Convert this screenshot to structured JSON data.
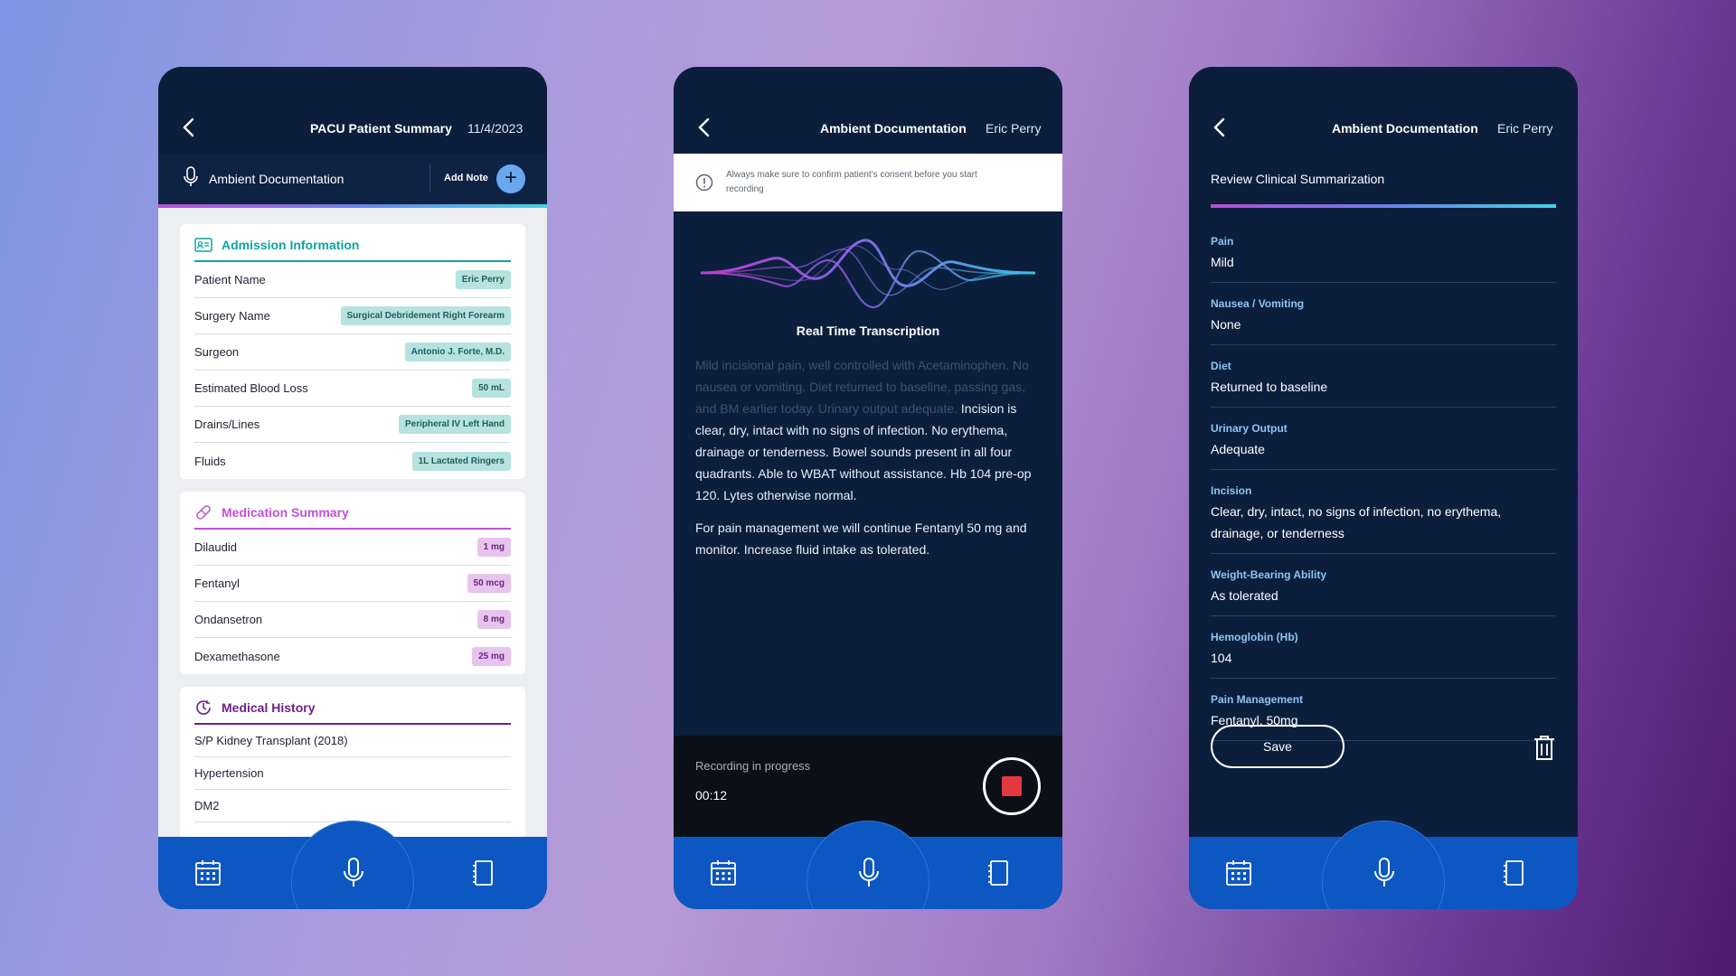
{
  "phone1": {
    "header": {
      "title": "PACU Patient Summary",
      "date": "11/4/2023"
    },
    "ambient_label": "Ambient Documentation",
    "add_note_label": "Add Note",
    "admission": {
      "title": "Admission Information",
      "accent": "#0fa3a3",
      "rows": [
        {
          "label": "Patient Name",
          "value": "Eric Perry"
        },
        {
          "label": "Surgery Name",
          "value": "Surgical Debridement Right Forearm"
        },
        {
          "label": "Surgeon",
          "value": "Antonio J. Forte, M.D."
        },
        {
          "label": "Estimated Blood Loss",
          "value": "50 mL"
        },
        {
          "label": "Drains/Lines",
          "value": "Peripheral IV Left Hand"
        },
        {
          "label": "Fluids",
          "value": "1L Lactated Ringers"
        }
      ]
    },
    "medication": {
      "title": "Medication Summary",
      "accent": "#c052d6",
      "rows": [
        {
          "label": "Dilaudid",
          "value": "1 mg"
        },
        {
          "label": "Fentanyl",
          "value": "50 mcg"
        },
        {
          "label": "Ondansetron",
          "value": "8 mg"
        },
        {
          "label": "Dexamethasone",
          "value": "25 mg"
        }
      ]
    },
    "history": {
      "title": "Medical History",
      "accent": "#6e1f8a",
      "items": [
        "S/P Kidney Transplant (2018)",
        "Hypertension",
        "DM2"
      ]
    }
  },
  "phone2": {
    "header": {
      "title": "Ambient Documentation",
      "user": "Eric Perry"
    },
    "consent": "Always make sure to confirm patient’s consent before you start recording",
    "realtime_title": "Real Time Transcription",
    "transcript_faded": "Mild incisional pain, well controlled with Acetaminophen. No nausea or vomiting. Diet returned to baseline, passing gas, and BM earlier today. Urinary output adequate.",
    "transcript_main": "Incision is clear, dry, intact with no signs of infection. No erythema, drainage or tenderness. Bowel sounds present in all four quadrants. Able to WBAT without assistance. Hb 104 pre-op 120. Lytes otherwise normal.",
    "transcript_plan": "For pain management we will continue Fentanyl 50 mg and monitor. Increase fluid intake as tolerated.",
    "recording_label": "Recording in progress",
    "recording_time": "00:12"
  },
  "phone3": {
    "header": {
      "title": "Ambient Documentation",
      "user": "Eric Perry"
    },
    "review_label": "Review Clinical Summarization",
    "fields": [
      {
        "label": "Pain",
        "value": "Mild"
      },
      {
        "label": "Nausea / Vomiting",
        "value": "None"
      },
      {
        "label": "Diet",
        "value": "Returned to baseline"
      },
      {
        "label": "Urinary Output",
        "value": "Adequate"
      },
      {
        "label": "Incision",
        "value": "Clear, dry, intact, no signs of infection, no erythema, drainage, or tenderness"
      },
      {
        "label": "Weight-Bearing Ability",
        "value": "As tolerated"
      },
      {
        "label": "Hemoglobin (Hb)",
        "value": "104"
      },
      {
        "label": "Pain Management",
        "value": "Fentanyl, 50mg"
      }
    ],
    "save_label": "Save"
  },
  "nav_icons": [
    "calendar-icon",
    "microphone-icon",
    "notepad-icon"
  ],
  "colors": {
    "nav_blue": "#0d57c2",
    "panel_navy": "#0b1f3d",
    "stop_red": "#e5383f"
  }
}
